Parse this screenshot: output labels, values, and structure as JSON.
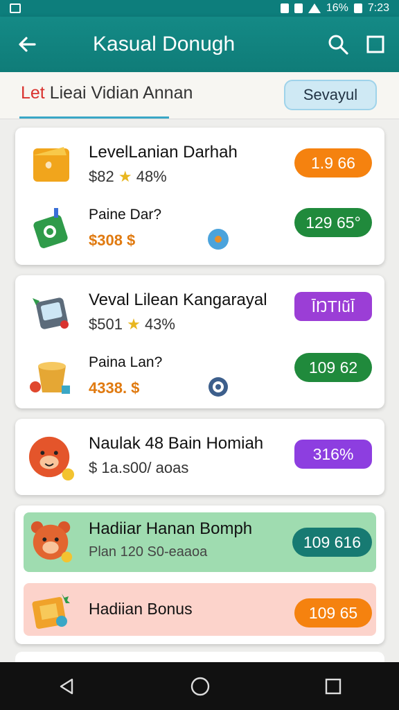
{
  "status": {
    "icons": [
      "image-icon",
      "vibrate-icon",
      "wifi-icon",
      "signal-icon",
      "battery-icon"
    ],
    "battery": "16%",
    "time": "7:23"
  },
  "app_bar": {
    "title": "Kasual Donugh",
    "back_icon": "arrow-left-icon",
    "search_icon": "search-icon",
    "menu_icon": "square-icon",
    "bg": "#0f7c78"
  },
  "tabs": {
    "label_red": "Let",
    "label_rest": "Lieai Vidian Annan",
    "pill": "Sevayul"
  },
  "cards": [
    {
      "rows": [
        {
          "title": "LevelLanian Darhah",
          "sub_a": "$82",
          "sub_b": "48%",
          "badge": "1.9 66",
          "badge_color": "#f5820f",
          "icon": "wallet-icon"
        },
        {
          "title": "Paine Dar?",
          "sub": "$308 $",
          "badge": "129 65°",
          "badge_color": "#208a3c",
          "icon": "bottle-icon",
          "mid_icon": "donut-icon"
        }
      ]
    },
    {
      "rows": [
        {
          "title": "Veval Lilean Kangarayal",
          "sub_a": "$501",
          "sub_b": "43%",
          "badge": "ĪŊTIũĪ",
          "badge_color": "#9b3ed6",
          "icon": "tablet-icon"
        },
        {
          "title": "Paina Lan?",
          "sub": "4338. $",
          "badge": "109 62",
          "badge_color": "#208a3c",
          "icon": "bucket-icon",
          "mid_icon": "gear-icon"
        }
      ]
    },
    {
      "rows": [
        {
          "title": "Naulak 48 Bain Homiah",
          "sub": "$ 1a.s00/ aoas",
          "badge": "316%",
          "badge_color": "#8d3ee0",
          "icon": "mascot-icon"
        }
      ]
    },
    {
      "rows": [
        {
          "title": "Hadiiar Hanan Bomph",
          "sub": "Plan 120 S0-eaaoa",
          "badge": "109 616",
          "badge_color": "#177a72",
          "icon": "bear-icon",
          "highlight": "#9fdcb0"
        },
        {
          "title": "Hadiian Bonus",
          "badge": "109 65",
          "badge_color": "#f5820f",
          "icon": "gift-box-icon",
          "highlight": "#fcd3cb"
        }
      ]
    }
  ],
  "nav": {
    "back": "nav-back-icon",
    "home": "nav-home-icon",
    "recents": "nav-recents-icon"
  }
}
